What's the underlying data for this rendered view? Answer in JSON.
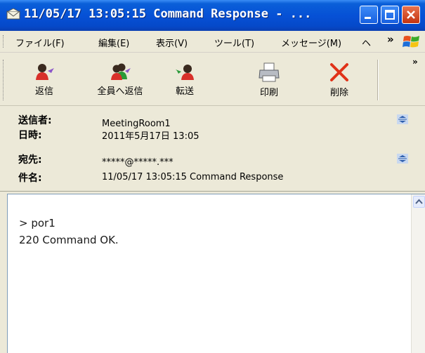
{
  "window": {
    "title": "11/05/17 13:05:15  Command Response - ..."
  },
  "menu": {
    "items": [
      "ファイル(F)",
      "編集(E)",
      "表示(V)",
      "ツール(T)",
      "メッセージ(M)",
      "ヘ"
    ],
    "overflow": "»"
  },
  "toolbar": {
    "buttons": [
      {
        "label": "返信",
        "icon": "reply-icon"
      },
      {
        "label": "全員へ返信",
        "icon": "reply-all-icon"
      },
      {
        "label": "転送",
        "icon": "forward-icon"
      },
      {
        "label": "印刷",
        "icon": "printer-icon"
      },
      {
        "label": "削除",
        "icon": "delete-icon"
      }
    ],
    "overflow": "»"
  },
  "header": {
    "from_label": "送信者:",
    "from_value": "MeetingRoom1",
    "date_label": "日時:",
    "date_value": "2011年5月17日 13:05",
    "to_label": "宛先:",
    "to_value": "*****@*****.***",
    "subject_label": "件名:",
    "subject_value": "11/05/17 13:05:15  Command Response"
  },
  "body": {
    "lines": [
      "> por1",
      "220 Command OK."
    ]
  },
  "colors": {
    "titlebar": "#0651d6",
    "chrome": "#ece9d8",
    "close_button": "#c3330f"
  }
}
